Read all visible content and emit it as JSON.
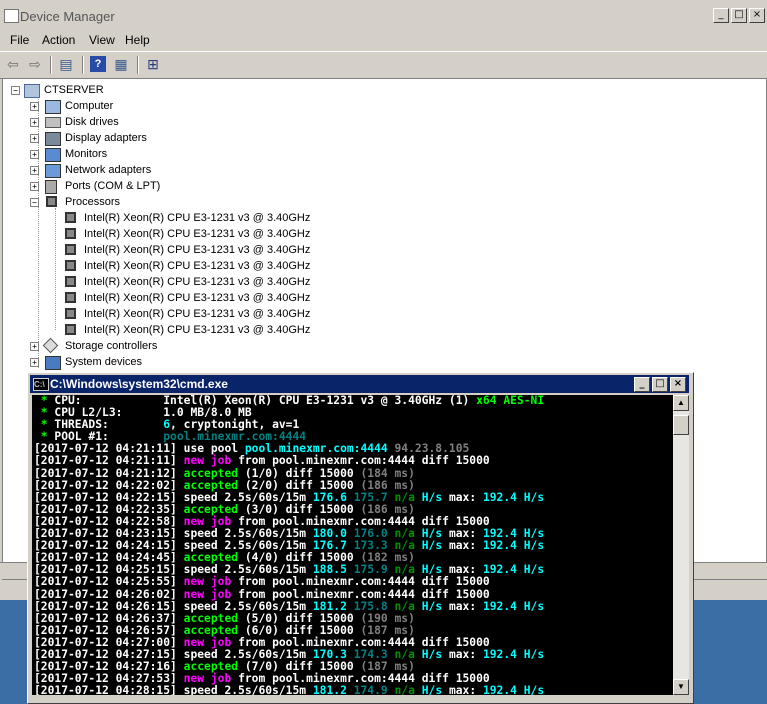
{
  "device_manager": {
    "title": "Device Manager",
    "menu": [
      "File",
      "Action",
      "View",
      "Help"
    ],
    "root": "CTSERVER",
    "categories": [
      {
        "label": "Computer",
        "icon": "computer-icon"
      },
      {
        "label": "Disk drives",
        "icon": "disk-icon"
      },
      {
        "label": "Display adapters",
        "icon": "display-icon"
      },
      {
        "label": "Monitors",
        "icon": "monitor-icon"
      },
      {
        "label": "Network adapters",
        "icon": "network-icon"
      },
      {
        "label": "Ports (COM & LPT)",
        "icon": "port-icon"
      },
      {
        "label": "Processors",
        "icon": "processor-icon"
      }
    ],
    "processors": [
      "Intel(R) Xeon(R) CPU E3-1231 v3 @ 3.40GHz",
      "Intel(R) Xeon(R) CPU E3-1231 v3 @ 3.40GHz",
      "Intel(R) Xeon(R) CPU E3-1231 v3 @ 3.40GHz",
      "Intel(R) Xeon(R) CPU E3-1231 v3 @ 3.40GHz",
      "Intel(R) Xeon(R) CPU E3-1231 v3 @ 3.40GHz",
      "Intel(R) Xeon(R) CPU E3-1231 v3 @ 3.40GHz",
      "Intel(R) Xeon(R) CPU E3-1231 v3 @ 3.40GHz",
      "Intel(R) Xeon(R) CPU E3-1231 v3 @ 3.40GHz"
    ],
    "more_categories": [
      {
        "label": "Storage controllers",
        "icon": "storage-icon"
      },
      {
        "label": "System devices",
        "icon": "system-icon"
      }
    ]
  },
  "cmd": {
    "title": "C:\\Windows\\system32\\cmd.exe",
    "lines": [
      [
        {
          "t": " * ",
          "c": "g b"
        },
        {
          "t": "CPU:            ",
          "c": "w b"
        },
        {
          "t": "Intel(R) Xeon(R) CPU E3-1231 v3 @ 3.40GHz (1) ",
          "c": "w b"
        },
        {
          "t": "x64 AES-NI",
          "c": "g b"
        }
      ],
      [
        {
          "t": " * ",
          "c": "g b"
        },
        {
          "t": "CPU L2/L3:      ",
          "c": "w b"
        },
        {
          "t": "1.0 MB/8.0 MB",
          "c": "w b"
        }
      ],
      [
        {
          "t": " * ",
          "c": "g b"
        },
        {
          "t": "THREADS:        ",
          "c": "w b"
        },
        {
          "t": "6",
          "c": "c b"
        },
        {
          "t": ", cryptonight, av=1",
          "c": "w b"
        }
      ],
      [
        {
          "t": " * ",
          "c": "g b"
        },
        {
          "t": "POOL #1:        ",
          "c": "w b"
        },
        {
          "t": "pool.minexmr.com:4444",
          "c": "dc b"
        }
      ],
      [
        {
          "t": "[2017-07-12 04:21:11] ",
          "c": "w b"
        },
        {
          "t": "use pool ",
          "c": "w b"
        },
        {
          "t": "pool.minexmr.com:4444 ",
          "c": "c b"
        },
        {
          "t": "94.23.8.105",
          "c": "gr b"
        }
      ],
      [
        {
          "t": "[2017-07-12 04:21:11] ",
          "c": "w b"
        },
        {
          "t": "new job ",
          "c": "m b"
        },
        {
          "t": "from pool.minexmr.com:4444 diff 15000",
          "c": "w b"
        }
      ],
      [
        {
          "t": "[2017-07-12 04:21:12] ",
          "c": "w b"
        },
        {
          "t": "accepted ",
          "c": "g b"
        },
        {
          "t": "(1/0) ",
          "c": "w b"
        },
        {
          "t": "diff 15000 ",
          "c": "w b"
        },
        {
          "t": "(184 ms)",
          "c": "gr b"
        }
      ],
      [
        {
          "t": "[2017-07-12 04:22:02] ",
          "c": "w b"
        },
        {
          "t": "accepted ",
          "c": "g b"
        },
        {
          "t": "(2/0) ",
          "c": "w b"
        },
        {
          "t": "diff 15000 ",
          "c": "w b"
        },
        {
          "t": "(186 ms)",
          "c": "gr b"
        }
      ],
      [
        {
          "t": "[2017-07-12 04:22:15] ",
          "c": "w b"
        },
        {
          "t": "speed 2.5s/60s/15m ",
          "c": "w b"
        },
        {
          "t": "176.6 ",
          "c": "c b"
        },
        {
          "t": "175.7 ",
          "c": "dc b"
        },
        {
          "t": "n/a ",
          "c": "dg b"
        },
        {
          "t": "H/s ",
          "c": "c b"
        },
        {
          "t": "max: ",
          "c": "w b"
        },
        {
          "t": "192.4 H/s",
          "c": "c b"
        }
      ],
      [
        {
          "t": "[2017-07-12 04:22:35] ",
          "c": "w b"
        },
        {
          "t": "accepted ",
          "c": "g b"
        },
        {
          "t": "(3/0) ",
          "c": "w b"
        },
        {
          "t": "diff 15000 ",
          "c": "w b"
        },
        {
          "t": "(186 ms)",
          "c": "gr b"
        }
      ],
      [
        {
          "t": "[2017-07-12 04:22:58] ",
          "c": "w b"
        },
        {
          "t": "new job ",
          "c": "m b"
        },
        {
          "t": "from pool.minexmr.com:4444 diff 15000",
          "c": "w b"
        }
      ],
      [
        {
          "t": "[2017-07-12 04:23:15] ",
          "c": "w b"
        },
        {
          "t": "speed 2.5s/60s/15m ",
          "c": "w b"
        },
        {
          "t": "180.0 ",
          "c": "c b"
        },
        {
          "t": "176.0 ",
          "c": "dc b"
        },
        {
          "t": "n/a ",
          "c": "dg b"
        },
        {
          "t": "H/s ",
          "c": "c b"
        },
        {
          "t": "max: ",
          "c": "w b"
        },
        {
          "t": "192.4 H/s",
          "c": "c b"
        }
      ],
      [
        {
          "t": "[2017-07-12 04:24:15] ",
          "c": "w b"
        },
        {
          "t": "speed 2.5s/60s/15m ",
          "c": "w b"
        },
        {
          "t": "176.7 ",
          "c": "c b"
        },
        {
          "t": "173.3 ",
          "c": "dc b"
        },
        {
          "t": "n/a ",
          "c": "dg b"
        },
        {
          "t": "H/s ",
          "c": "c b"
        },
        {
          "t": "max: ",
          "c": "w b"
        },
        {
          "t": "192.4 H/s",
          "c": "c b"
        }
      ],
      [
        {
          "t": "[2017-07-12 04:24:45] ",
          "c": "w b"
        },
        {
          "t": "accepted ",
          "c": "g b"
        },
        {
          "t": "(4/0) ",
          "c": "w b"
        },
        {
          "t": "diff 15000 ",
          "c": "w b"
        },
        {
          "t": "(182 ms)",
          "c": "gr b"
        }
      ],
      [
        {
          "t": "[2017-07-12 04:25:15] ",
          "c": "w b"
        },
        {
          "t": "speed 2.5s/60s/15m ",
          "c": "w b"
        },
        {
          "t": "188.5 ",
          "c": "c b"
        },
        {
          "t": "175.9 ",
          "c": "dc b"
        },
        {
          "t": "n/a ",
          "c": "dg b"
        },
        {
          "t": "H/s ",
          "c": "c b"
        },
        {
          "t": "max: ",
          "c": "w b"
        },
        {
          "t": "192.4 H/s",
          "c": "c b"
        }
      ],
      [
        {
          "t": "[2017-07-12 04:25:55] ",
          "c": "w b"
        },
        {
          "t": "new job ",
          "c": "m b"
        },
        {
          "t": "from pool.minexmr.com:4444 diff 15000",
          "c": "w b"
        }
      ],
      [
        {
          "t": "[2017-07-12 04:26:02] ",
          "c": "w b"
        },
        {
          "t": "new job ",
          "c": "m b"
        },
        {
          "t": "from pool.minexmr.com:4444 diff 15000",
          "c": "w b"
        }
      ],
      [
        {
          "t": "[2017-07-12 04:26:15] ",
          "c": "w b"
        },
        {
          "t": "speed 2.5s/60s/15m ",
          "c": "w b"
        },
        {
          "t": "181.2 ",
          "c": "c b"
        },
        {
          "t": "175.8 ",
          "c": "dc b"
        },
        {
          "t": "n/a ",
          "c": "dg b"
        },
        {
          "t": "H/s ",
          "c": "c b"
        },
        {
          "t": "max: ",
          "c": "w b"
        },
        {
          "t": "192.4 H/s",
          "c": "c b"
        }
      ],
      [
        {
          "t": "[2017-07-12 04:26:37] ",
          "c": "w b"
        },
        {
          "t": "accepted ",
          "c": "g b"
        },
        {
          "t": "(5/0) ",
          "c": "w b"
        },
        {
          "t": "diff 15000 ",
          "c": "w b"
        },
        {
          "t": "(190 ms)",
          "c": "gr b"
        }
      ],
      [
        {
          "t": "[2017-07-12 04:26:57] ",
          "c": "w b"
        },
        {
          "t": "accepted ",
          "c": "g b"
        },
        {
          "t": "(6/0) ",
          "c": "w b"
        },
        {
          "t": "diff 15000 ",
          "c": "w b"
        },
        {
          "t": "(187 ms)",
          "c": "gr b"
        }
      ],
      [
        {
          "t": "[2017-07-12 04:27:00] ",
          "c": "w b"
        },
        {
          "t": "new job ",
          "c": "m b"
        },
        {
          "t": "from pool.minexmr.com:4444 diff 15000",
          "c": "w b"
        }
      ],
      [
        {
          "t": "[2017-07-12 04:27:15] ",
          "c": "w b"
        },
        {
          "t": "speed 2.5s/60s/15m ",
          "c": "w b"
        },
        {
          "t": "170.3 ",
          "c": "c b"
        },
        {
          "t": "174.3 ",
          "c": "dc b"
        },
        {
          "t": "n/a ",
          "c": "dg b"
        },
        {
          "t": "H/s ",
          "c": "c b"
        },
        {
          "t": "max: ",
          "c": "w b"
        },
        {
          "t": "192.4 H/s",
          "c": "c b"
        }
      ],
      [
        {
          "t": "[2017-07-12 04:27:16] ",
          "c": "w b"
        },
        {
          "t": "accepted ",
          "c": "g b"
        },
        {
          "t": "(7/0) ",
          "c": "w b"
        },
        {
          "t": "diff 15000 ",
          "c": "w b"
        },
        {
          "t": "(187 ms)",
          "c": "gr b"
        }
      ],
      [
        {
          "t": "[2017-07-12 04:27:53] ",
          "c": "w b"
        },
        {
          "t": "new job ",
          "c": "m b"
        },
        {
          "t": "from pool.minexmr.com:4444 diff 15000",
          "c": "w b"
        }
      ],
      [
        {
          "t": "[2017-07-12 04:28:15] ",
          "c": "w b"
        },
        {
          "t": "speed 2.5s/60s/15m ",
          "c": "w b"
        },
        {
          "t": "181.2 ",
          "c": "c b"
        },
        {
          "t": "174.9 ",
          "c": "dc b"
        },
        {
          "t": "n/a ",
          "c": "dg b"
        },
        {
          "t": "H/s ",
          "c": "c b"
        },
        {
          "t": "max: ",
          "c": "w b"
        },
        {
          "t": "192.4 H/s",
          "c": "c b"
        }
      ]
    ]
  }
}
